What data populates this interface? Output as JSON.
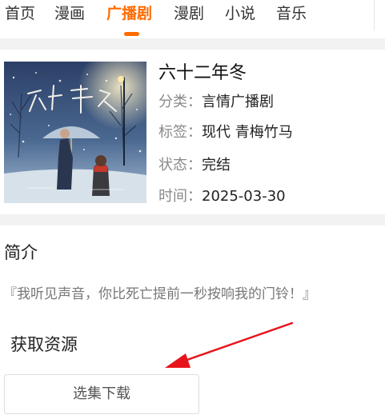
{
  "tabs": [
    {
      "label": "首页",
      "active": false
    },
    {
      "label": "漫画",
      "active": false
    },
    {
      "label": "广播剧",
      "active": true
    },
    {
      "label": "漫剧",
      "active": false
    },
    {
      "label": "小说",
      "active": false
    },
    {
      "label": "音乐",
      "active": false
    }
  ],
  "detail": {
    "title": "六十二年冬",
    "category_label": "分类：",
    "category_value": "言情广播剧",
    "tags_label": "标签：",
    "tags_value": "现代 青梅竹马",
    "status_label": "状态：",
    "status_value": "完结",
    "date_label": "时间：",
    "date_value": "2025-03-30"
  },
  "intro": {
    "heading": "简介",
    "text": "『我听见声音，你比死亡提前一秒按响我的门铃！』"
  },
  "resources": {
    "heading": "获取资源",
    "download_button": "选集下载"
  },
  "colors": {
    "accent": "#ff6a00",
    "section_gap": "#f2f2f2",
    "annotation_arrow": "#e8141b"
  },
  "icons": {
    "annotation": "red-arrow-icon"
  }
}
